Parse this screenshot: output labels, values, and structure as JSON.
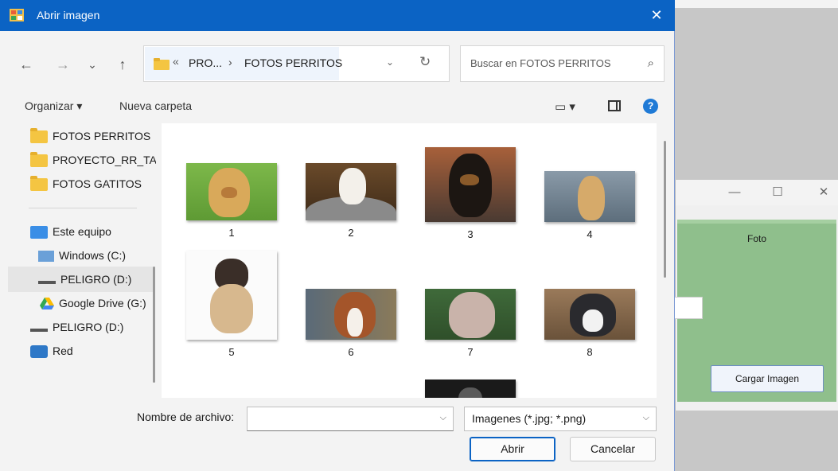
{
  "dialog": {
    "title": "Abrir imagen",
    "close_icon": "close-icon",
    "nav": {
      "back": "←",
      "forward": "→",
      "recent": "⌄",
      "up": "↑"
    },
    "address": {
      "overflow": "«",
      "segments": [
        "PRO...",
        "FOTOS PERRITOS"
      ],
      "separator": "›"
    },
    "search_placeholder": "Buscar en FOTOS PERRITOS",
    "toolbar": {
      "organize": "Organizar ▾",
      "new_folder": "Nueva carpeta"
    },
    "sidebar": [
      {
        "label": "FOTOS PERRITOS",
        "icon": "folder-icon"
      },
      {
        "label": "PROYECTO_RR_TA",
        "icon": "folder-icon"
      },
      {
        "label": "FOTOS GATITOS",
        "icon": "folder-icon"
      },
      {
        "label": "Este equipo",
        "icon": "computer-icon"
      },
      {
        "label": "Windows (C:)",
        "icon": "windows-drive-icon"
      },
      {
        "label": "PELIGRO (D:)",
        "icon": "drive-icon",
        "selected": true
      },
      {
        "label": "Google Drive (G:)",
        "icon": "google-drive-icon"
      },
      {
        "label": "PELIGRO (D:)",
        "icon": "drive-icon"
      },
      {
        "label": "Red",
        "icon": "network-icon"
      }
    ],
    "files": [
      "1",
      "2",
      "3",
      "4",
      "5",
      "6",
      "7",
      "8"
    ],
    "filename_label": "Nombre de archivo:",
    "filename_value": "",
    "filter_value": "Imagenes (*.jpg; *.png)",
    "open_button": "Abrir",
    "cancel_button": "Cancelar"
  },
  "background_window": {
    "group_label": "Foto",
    "load_button": "Cargar Imagen",
    "controls": {
      "minimize": "—",
      "maximize": "☐",
      "close": "✕"
    }
  },
  "colors": {
    "titlebar": "#0b63c4",
    "panel_green": "#8fbf8c"
  }
}
